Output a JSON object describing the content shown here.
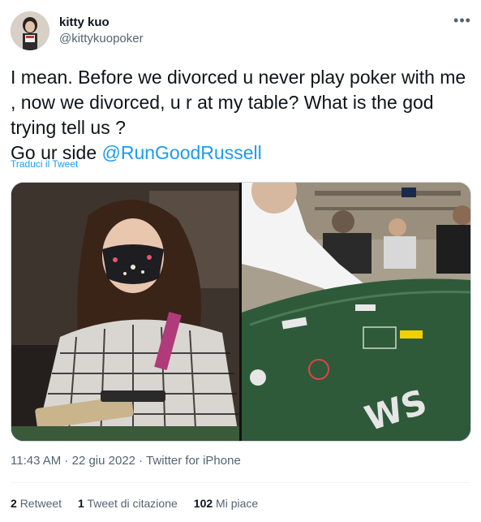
{
  "author": {
    "name": "kitty kuo",
    "handle": "@kittykuopoker"
  },
  "tweet": {
    "lines": [
      "I mean. Before we divorced u never play poker with me",
      ", now we divorced, u r at my table? What is the god",
      "trying tell us ?"
    ],
    "line4_prefix": "Go ur side ",
    "mention": "@RunGoodRussell",
    "translate_label": "Traduci il Tweet"
  },
  "meta": {
    "time": "11:43 AM",
    "separator1": " · ",
    "date": "22 giu 2022",
    "separator2": " · ",
    "source": "Twitter for iPhone"
  },
  "stats": {
    "retweets_count": "2",
    "retweets_label": "Retweet",
    "quotes_count": "1",
    "quotes_label": "Tweet di citazione",
    "likes_count": "102",
    "likes_label": "Mi piace"
  },
  "colors": {
    "accent": "#1d9bf0",
    "secondary_text": "#536471",
    "primary_text": "#0f1419"
  },
  "icons": {
    "more": "more-options-icon"
  }
}
